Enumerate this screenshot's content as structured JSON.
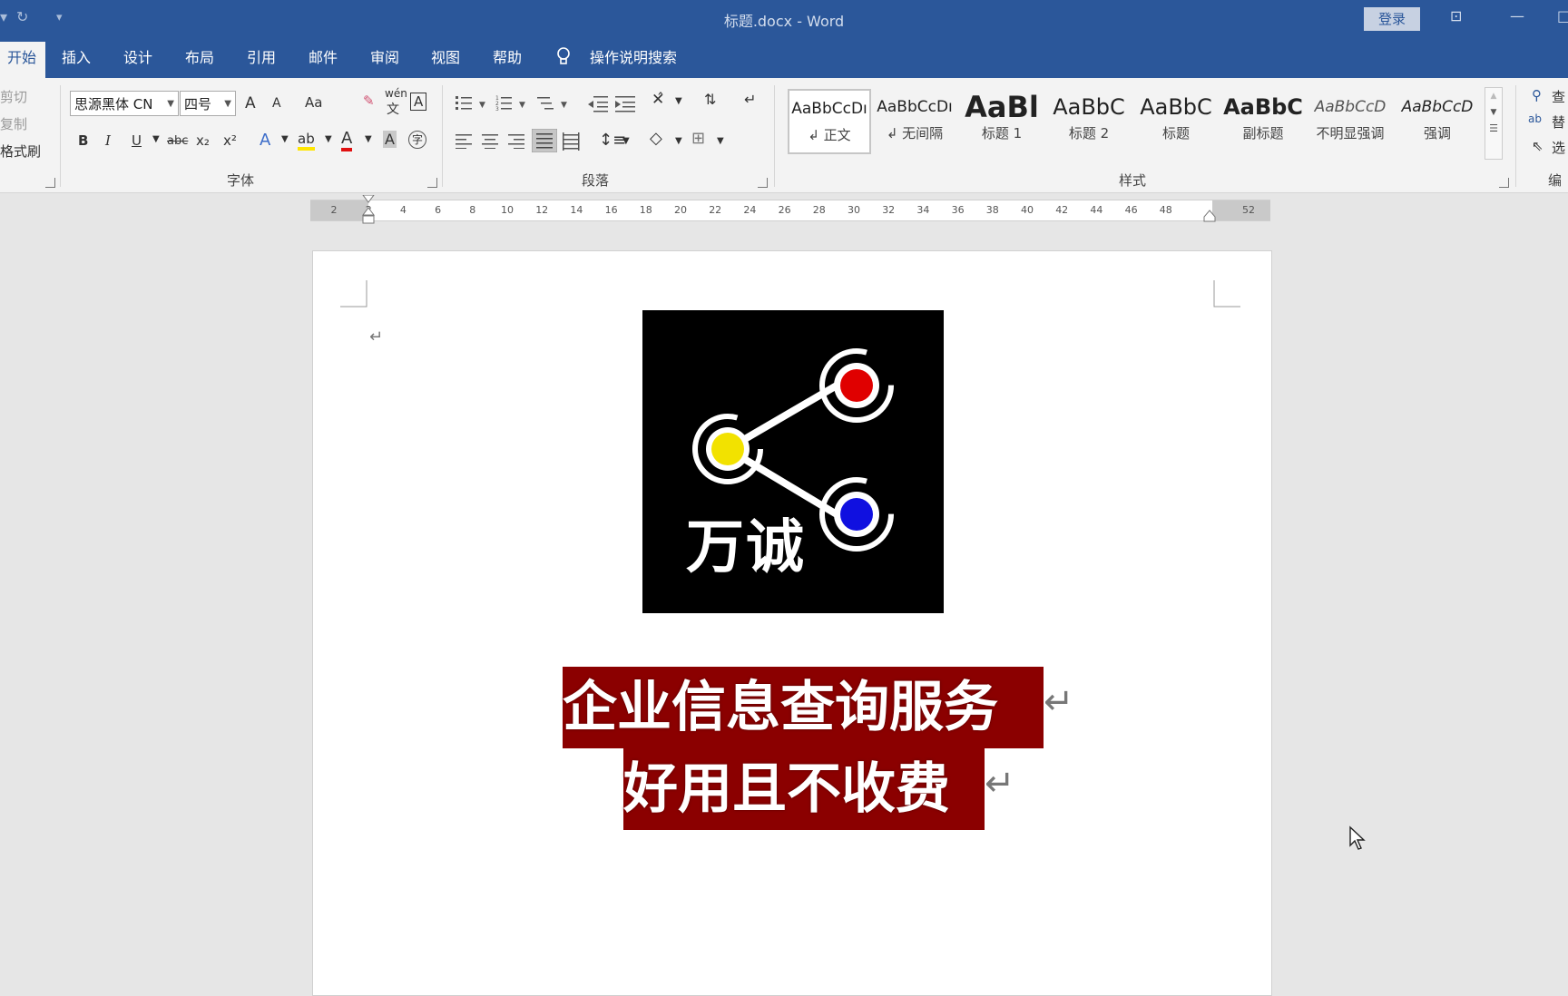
{
  "window": {
    "title": "标题.docx  -  Word",
    "login_label": "登录",
    "controls": {
      "ribbon_display": "⊡",
      "minimize": "—",
      "maximize": "□"
    }
  },
  "quick_access": {
    "redo_icon": "↻",
    "customize_icon": "▾"
  },
  "tabs": [
    {
      "label": "开始",
      "active": true
    },
    {
      "label": "插入"
    },
    {
      "label": "设计"
    },
    {
      "label": "布局"
    },
    {
      "label": "引用"
    },
    {
      "label": "邮件"
    },
    {
      "label": "审阅"
    },
    {
      "label": "视图"
    },
    {
      "label": "帮助"
    }
  ],
  "tell_me": {
    "label": "操作说明搜索",
    "icon": "lightbulb-icon"
  },
  "clipboard": {
    "cut": "剪切",
    "copy": "复制",
    "format_painter": "格式刷"
  },
  "font": {
    "group_label": "字体",
    "font_name": "思源黑体 CN",
    "font_size": "四号",
    "grow": "A",
    "shrink": "A",
    "change_case": "Aa",
    "phonetic": "wén",
    "phonetic_char": "文",
    "char_border": "A",
    "bold": "B",
    "italic": "I",
    "underline": "U",
    "strike": "abc",
    "subscript": "x₂",
    "superscript": "x²",
    "text_effect": "A",
    "highlight": "ab",
    "font_color": "A",
    "char_shading": "A",
    "enclose": "字",
    "font_color_value": "#e01010",
    "highlight_value": "#ffe600"
  },
  "paragraph": {
    "group_label": "段落"
  },
  "styles": {
    "group_label": "样式",
    "items": [
      {
        "preview": "AaBbCcDı",
        "name": "↲ 正文"
      },
      {
        "preview": "AaBbCcDı",
        "name": "↲ 无间隔"
      },
      {
        "preview": "AaBl",
        "name": "标题 1"
      },
      {
        "preview": "AaBbC",
        "name": "标题 2"
      },
      {
        "preview": "AaBbC",
        "name": "标题"
      },
      {
        "preview": "AaBbC",
        "name": "副标题"
      },
      {
        "preview": "AaBbCcD",
        "name": "不明显强调"
      },
      {
        "preview": "AaBbCcD",
        "name": "强调"
      }
    ]
  },
  "editing": {
    "group_label": "编",
    "find": "查",
    "replace": "替",
    "select": "选"
  },
  "ruler": {
    "ticks": [
      "2",
      "2",
      "4",
      "6",
      "8",
      "10",
      "12",
      "14",
      "16",
      "18",
      "20",
      "22",
      "24",
      "26",
      "28",
      "30",
      "32",
      "34",
      "36",
      "38",
      "40",
      "42",
      "44",
      "46",
      "48",
      "52"
    ]
  },
  "document": {
    "logo_text": "万诚",
    "logo_colors": {
      "red": "#e00000",
      "yellow": "#f2e200",
      "blue": "#1010e0"
    },
    "heading_lines": [
      "企业信息查询服务",
      "好用且不收费"
    ],
    "highlight_color": "#8b0000",
    "paragraph_mark": "↵"
  }
}
